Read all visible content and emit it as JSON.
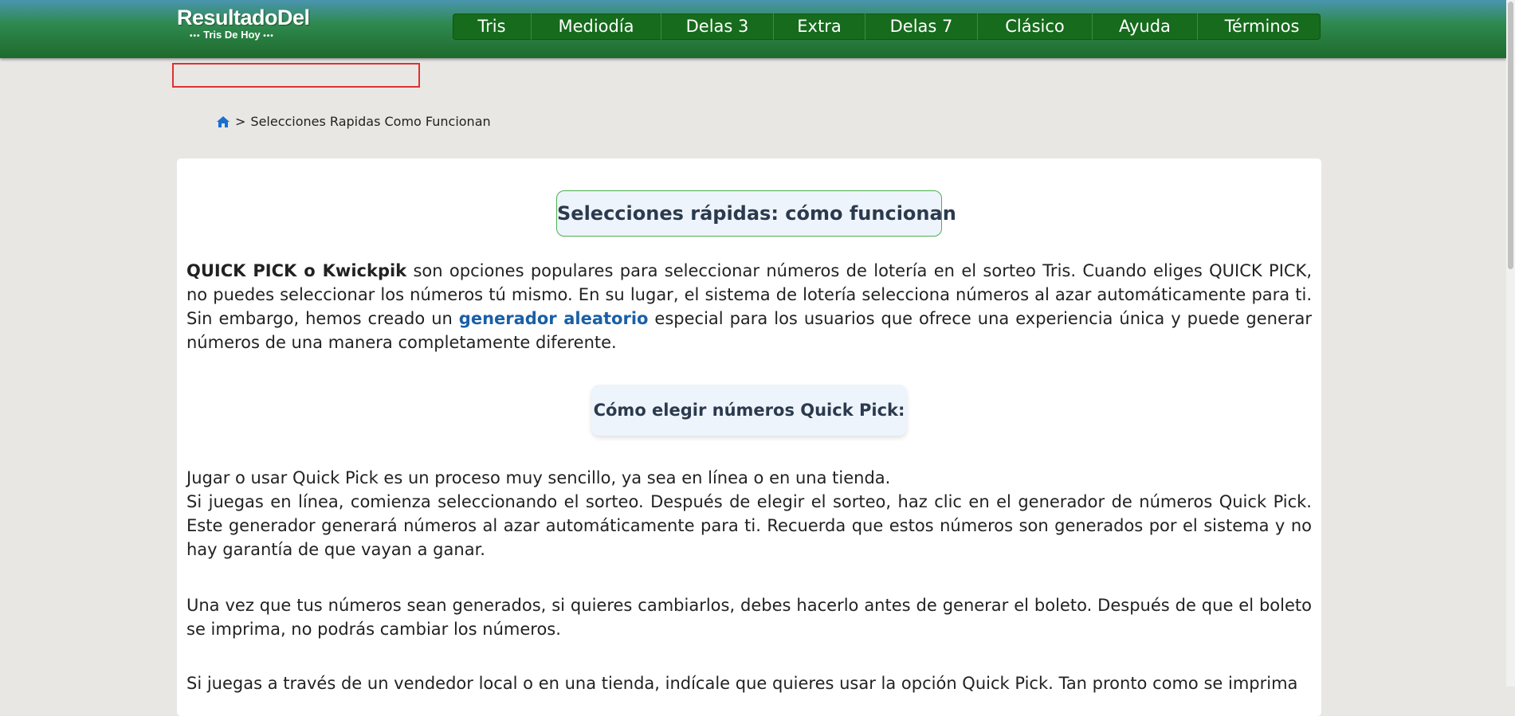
{
  "header": {
    "logo_line1": "ResultadoDel",
    "logo_line2": "Tris De Hoy",
    "nav": [
      {
        "label": "Tris"
      },
      {
        "label": "Mediodía"
      },
      {
        "label": "Delas 3"
      },
      {
        "label": "Extra"
      },
      {
        "label": "Delas 7"
      },
      {
        "label": "Clásico"
      },
      {
        "label": "Ayuda"
      },
      {
        "label": "Términos"
      }
    ]
  },
  "breadcrumb": {
    "home_icon": "home-icon",
    "separator": ">",
    "current": "Selecciones Rapidas Como Funcionan"
  },
  "content": {
    "title": "Selecciones rápidas: cómo funcionan",
    "intro_bold": "QUICK PICK o Kwickpik",
    "intro_text1": " son opciones populares para seleccionar números de lotería en el sorteo Tris. Cuando eliges QUICK PICK, no puedes seleccionar los números tú mismo. En su lugar, el sistema de lotería selecciona números al azar automáticamente para ti. Sin embargo, hemos creado un ",
    "intro_link": "generador aleatorio",
    "intro_text2": " especial para los usuarios que ofrece una experiencia única y puede generar números de una manera completamente diferente.",
    "subtitle": "Cómo elegir números Quick Pick:",
    "para1_line1": "Jugar o usar Quick Pick es un proceso muy sencillo, ya sea en línea o en una tienda.",
    "para1_line2": "Si juegas en línea, comienza seleccionando el sorteo. Después de elegir el sorteo, haz clic en el generador de números Quick Pick. Este generador generará números al azar automáticamente para ti. Recuerda que estos números son generados por el sistema y no hay garantía de que vayan a ganar.",
    "para2": "Una vez que tus números sean generados, si quieres cambiarlos, debes hacerlo antes de generar el boleto. Después de que el boleto se imprima, no podrás cambiar los números.",
    "para3": "Si juegas a través de un vendedor local o en una tienda, indícale que quieres usar la opción Quick Pick. Tan pronto como se imprima"
  },
  "colors": {
    "header_green": "#1e6a2d",
    "nav_green": "#166b1c",
    "link_blue": "#1a5fa6",
    "title_border": "#4caf50"
  }
}
